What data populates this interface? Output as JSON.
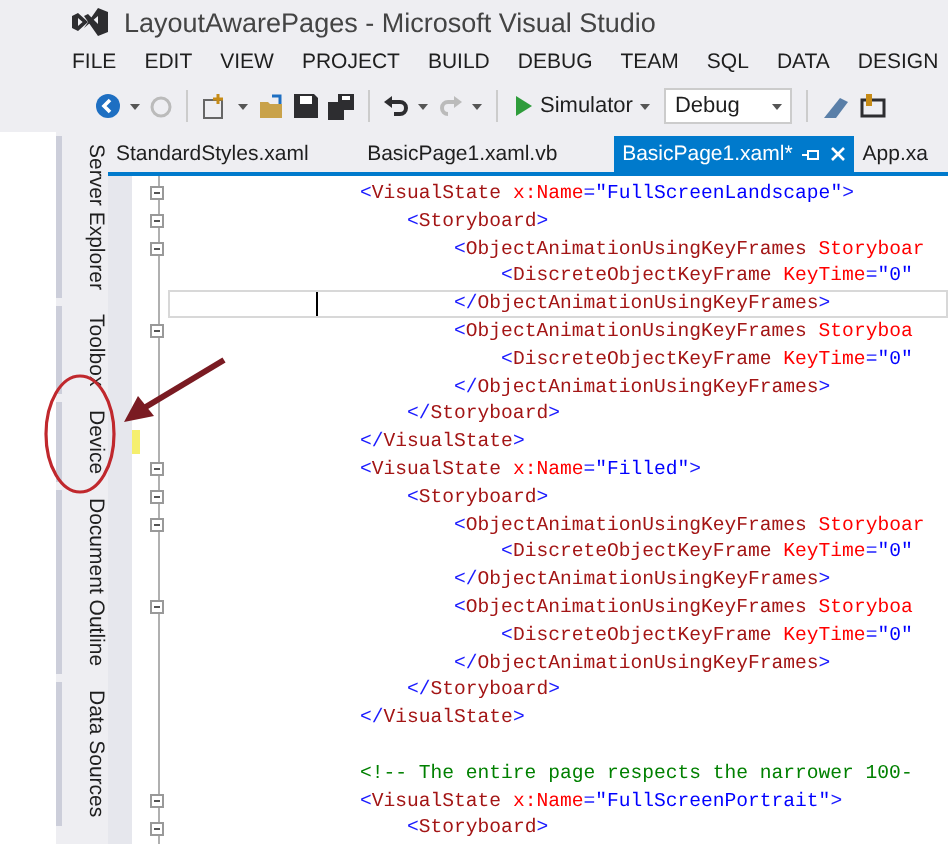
{
  "window": {
    "title": "LayoutAwarePages - Microsoft Visual Studio"
  },
  "menu": [
    "FILE",
    "EDIT",
    "VIEW",
    "PROJECT",
    "BUILD",
    "DEBUG",
    "TEAM",
    "SQL",
    "DATA",
    "DESIGN"
  ],
  "toolbar": {
    "run_target": "Simulator",
    "configuration": "Debug"
  },
  "side_tabs": [
    {
      "label": "Server Explorer",
      "selected": false
    },
    {
      "label": "Toolbox",
      "selected": false
    },
    {
      "label": "Device",
      "selected": false
    },
    {
      "label": "Document Outline",
      "selected": false
    },
    {
      "label": "Data Sources",
      "selected": false
    }
  ],
  "tabs": [
    {
      "label": "StandardStyles.xaml",
      "selected": false
    },
    {
      "label": "BasicPage1.xaml.vb",
      "selected": false
    },
    {
      "label": "BasicPage1.xaml*",
      "selected": true
    },
    {
      "label": "App.xa",
      "selected": false
    }
  ],
  "code_lines": [
    {
      "fold": true,
      "changed": false,
      "current": false,
      "segments": [
        {
          "kind": "delim",
          "text": "<"
        },
        {
          "kind": "name",
          "text": "VisualState"
        },
        {
          "kind": "attr",
          "text": " x:Name"
        },
        {
          "kind": "delim",
          "text": "="
        },
        {
          "kind": "value",
          "text": "\"FullScreenLandscape\""
        },
        {
          "kind": "delim",
          "text": ">"
        }
      ]
    },
    {
      "fold": true,
      "changed": false,
      "current": false,
      "segments": [
        {
          "kind": "delim",
          "text": "    <"
        },
        {
          "kind": "name",
          "text": "Storyboard"
        },
        {
          "kind": "delim",
          "text": ">"
        }
      ]
    },
    {
      "fold": true,
      "changed": false,
      "current": false,
      "segments": [
        {
          "kind": "delim",
          "text": "        <"
        },
        {
          "kind": "name",
          "text": "ObjectAnimationUsingKeyFrames"
        },
        {
          "kind": "attr",
          "text": " Storyboar"
        }
      ]
    },
    {
      "fold": false,
      "changed": false,
      "current": false,
      "segments": [
        {
          "kind": "delim",
          "text": "            <"
        },
        {
          "kind": "name",
          "text": "DiscreteObjectKeyFrame"
        },
        {
          "kind": "attr",
          "text": " KeyTime"
        },
        {
          "kind": "delim",
          "text": "="
        },
        {
          "kind": "value",
          "text": "\"0\""
        }
      ]
    },
    {
      "fold": false,
      "changed": false,
      "current": true,
      "segments": [
        {
          "kind": "delim",
          "text": "        </"
        },
        {
          "kind": "name",
          "text": "ObjectAnimationUsingKeyFrames"
        },
        {
          "kind": "delim",
          "text": ">"
        }
      ]
    },
    {
      "fold": true,
      "changed": false,
      "current": false,
      "segments": [
        {
          "kind": "delim",
          "text": "        <"
        },
        {
          "kind": "name",
          "text": "ObjectAnimationUsingKeyFrames"
        },
        {
          "kind": "attr",
          "text": " Storyboa"
        }
      ]
    },
    {
      "fold": false,
      "changed": false,
      "current": false,
      "segments": [
        {
          "kind": "delim",
          "text": "            <"
        },
        {
          "kind": "name",
          "text": "DiscreteObjectKeyFrame"
        },
        {
          "kind": "attr",
          "text": " KeyTime"
        },
        {
          "kind": "delim",
          "text": "="
        },
        {
          "kind": "value",
          "text": "\"0\""
        }
      ]
    },
    {
      "fold": false,
      "changed": false,
      "current": false,
      "segments": [
        {
          "kind": "delim",
          "text": "        </"
        },
        {
          "kind": "name",
          "text": "ObjectAnimationUsingKeyFrames"
        },
        {
          "kind": "delim",
          "text": ">"
        }
      ]
    },
    {
      "fold": false,
      "changed": false,
      "current": false,
      "segments": [
        {
          "kind": "delim",
          "text": "    </"
        },
        {
          "kind": "name",
          "text": "Storyboard"
        },
        {
          "kind": "delim",
          "text": ">"
        }
      ]
    },
    {
      "fold": false,
      "changed": true,
      "current": false,
      "segments": [
        {
          "kind": "delim",
          "text": "</"
        },
        {
          "kind": "name",
          "text": "VisualState"
        },
        {
          "kind": "delim",
          "text": ">"
        }
      ]
    },
    {
      "fold": true,
      "changed": false,
      "current": false,
      "segments": [
        {
          "kind": "delim",
          "text": "<"
        },
        {
          "kind": "name",
          "text": "VisualState"
        },
        {
          "kind": "attr",
          "text": " x:Name"
        },
        {
          "kind": "delim",
          "text": "="
        },
        {
          "kind": "value",
          "text": "\"Filled\""
        },
        {
          "kind": "delim",
          "text": ">"
        }
      ]
    },
    {
      "fold": true,
      "changed": false,
      "current": false,
      "segments": [
        {
          "kind": "delim",
          "text": "    <"
        },
        {
          "kind": "name",
          "text": "Storyboard"
        },
        {
          "kind": "delim",
          "text": ">"
        }
      ]
    },
    {
      "fold": true,
      "changed": false,
      "current": false,
      "segments": [
        {
          "kind": "delim",
          "text": "        <"
        },
        {
          "kind": "name",
          "text": "ObjectAnimationUsingKeyFrames"
        },
        {
          "kind": "attr",
          "text": " Storyboar"
        }
      ]
    },
    {
      "fold": false,
      "changed": false,
      "current": false,
      "segments": [
        {
          "kind": "delim",
          "text": "            <"
        },
        {
          "kind": "name",
          "text": "DiscreteObjectKeyFrame"
        },
        {
          "kind": "attr",
          "text": " KeyTime"
        },
        {
          "kind": "delim",
          "text": "="
        },
        {
          "kind": "value",
          "text": "\"0\""
        }
      ]
    },
    {
      "fold": false,
      "changed": false,
      "current": false,
      "segments": [
        {
          "kind": "delim",
          "text": "        </"
        },
        {
          "kind": "name",
          "text": "ObjectAnimationUsingKeyFrames"
        },
        {
          "kind": "delim",
          "text": ">"
        }
      ]
    },
    {
      "fold": true,
      "changed": false,
      "current": false,
      "segments": [
        {
          "kind": "delim",
          "text": "        <"
        },
        {
          "kind": "name",
          "text": "ObjectAnimationUsingKeyFrames"
        },
        {
          "kind": "attr",
          "text": " Storyboa"
        }
      ]
    },
    {
      "fold": false,
      "changed": false,
      "current": false,
      "segments": [
        {
          "kind": "delim",
          "text": "            <"
        },
        {
          "kind": "name",
          "text": "DiscreteObjectKeyFrame"
        },
        {
          "kind": "attr",
          "text": " KeyTime"
        },
        {
          "kind": "delim",
          "text": "="
        },
        {
          "kind": "value",
          "text": "\"0\""
        }
      ]
    },
    {
      "fold": false,
      "changed": false,
      "current": false,
      "segments": [
        {
          "kind": "delim",
          "text": "        </"
        },
        {
          "kind": "name",
          "text": "ObjectAnimationUsingKeyFrames"
        },
        {
          "kind": "delim",
          "text": ">"
        }
      ]
    },
    {
      "fold": false,
      "changed": false,
      "current": false,
      "segments": [
        {
          "kind": "delim",
          "text": "    </"
        },
        {
          "kind": "name",
          "text": "Storyboard"
        },
        {
          "kind": "delim",
          "text": ">"
        }
      ]
    },
    {
      "fold": false,
      "changed": false,
      "current": false,
      "segments": [
        {
          "kind": "delim",
          "text": "</"
        },
        {
          "kind": "name",
          "text": "VisualState"
        },
        {
          "kind": "delim",
          "text": ">"
        }
      ]
    },
    {
      "fold": false,
      "changed": false,
      "current": false
    },
    {
      "fold": false,
      "changed": false,
      "current": false,
      "segments": [
        {
          "kind": "comment",
          "text": "<!-- The entire page respects the narrower 100-"
        }
      ]
    },
    {
      "fold": true,
      "changed": false,
      "current": false,
      "segments": [
        {
          "kind": "delim",
          "text": "<"
        },
        {
          "kind": "name",
          "text": "VisualState"
        },
        {
          "kind": "attr",
          "text": " x:Name"
        },
        {
          "kind": "delim",
          "text": "="
        },
        {
          "kind": "value",
          "text": "\"FullScreenPortrait\""
        },
        {
          "kind": "delim",
          "text": ">"
        }
      ]
    },
    {
      "fold": true,
      "changed": false,
      "current": false,
      "segments": [
        {
          "kind": "delim",
          "text": "    <"
        },
        {
          "kind": "name",
          "text": "Storyboard"
        },
        {
          "kind": "delim",
          "text": ">"
        }
      ]
    }
  ]
}
